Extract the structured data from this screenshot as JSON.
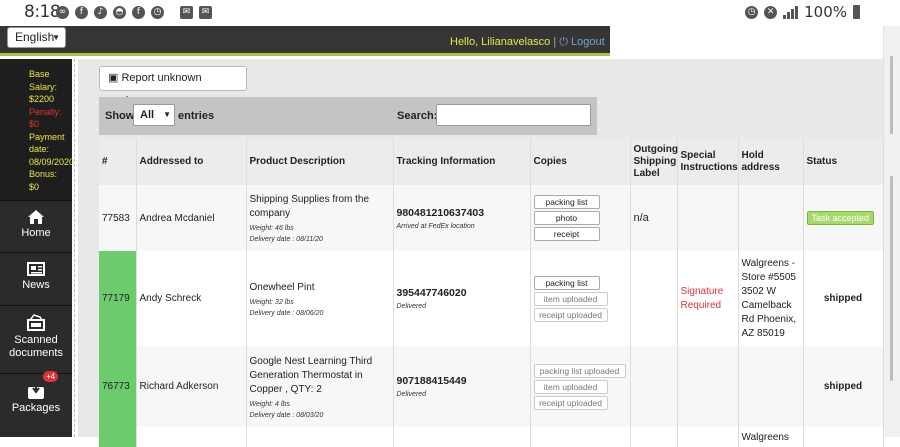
{
  "status_bar": {
    "time": "8:18",
    "battery": "100%"
  },
  "header": {
    "language": "English",
    "greeting": "Hello, Lilianavelasco",
    "separator": "|",
    "logout": "Logout"
  },
  "sidebar": {
    "info": {
      "base_salary_label": "Base Salary:",
      "base_salary_value": "$2200",
      "penalty_label": "Penalty:",
      "penalty_value": "$0",
      "payment_date_label": "Payment date:",
      "payment_date_value": "08/09/2020",
      "bonus_label": "Bonus:",
      "bonus_value": "$0"
    },
    "items": [
      {
        "label": "Home",
        "icon": "home-icon"
      },
      {
        "label": "News",
        "icon": "newspaper-icon"
      },
      {
        "label": "Scanned documents",
        "icon": "scanned-documents-icon"
      },
      {
        "label": "Packages",
        "icon": "packages-icon",
        "badge": "+4"
      }
    ]
  },
  "toolbar": {
    "report_button": "Report unknown package"
  },
  "controls": {
    "show": "Show",
    "show_value": "All",
    "entries": "entries",
    "search": "Search:"
  },
  "table": {
    "headers": [
      "#",
      "Addressed to",
      "Product Description",
      "Tracking Information",
      "Copies",
      "Outgoing Shipping Label",
      "Special Instructions",
      "Hold address",
      "Status"
    ],
    "rows": [
      {
        "id": "77583",
        "addressed_to": "Andrea Mcdaniel",
        "product": "Shipping Supplies from the company",
        "weight": "Weight: 46 lbs",
        "delivery": "Delivery date : 08/11/20",
        "tracking": "980481210637403",
        "tracking_status": "Arrived at FedEx location",
        "copies": [
          "packing list",
          "photo",
          "receipt"
        ],
        "outgoing": "n/a",
        "special": "",
        "hold": "",
        "status": "Task accepted"
      },
      {
        "id": "77179",
        "addressed_to": "Andy Schreck",
        "product": "Onewheel Pint",
        "weight": "Weight: 32 lbs",
        "delivery": "Delivery date : 08/06/20",
        "tracking": "395447746020",
        "tracking_status": "Delivered",
        "copies": [
          "packing list",
          "item uploaded",
          "receipt uploaded"
        ],
        "outgoing": "",
        "special": "Signature Required",
        "hold": "Walgreens - Store #5505 3502 W Camelback Rd Phoenix, AZ 85019",
        "status": "shipped"
      },
      {
        "id": "76773",
        "addressed_to": "Richard Adkerson",
        "product": "Google Nest Learning Third Generation Thermostat in Copper , QTY: 2",
        "weight": "Weight: 4 lbs",
        "delivery": "Delivery date : 08/03/20",
        "tracking": "907188415449",
        "tracking_status": "Delivered",
        "copies": [
          "packing list uploaded",
          "item uploaded",
          "receipt uploaded"
        ],
        "outgoing": "",
        "special": "",
        "hold": "",
        "status": "shipped"
      },
      {
        "hold": "Walgreens"
      }
    ]
  }
}
